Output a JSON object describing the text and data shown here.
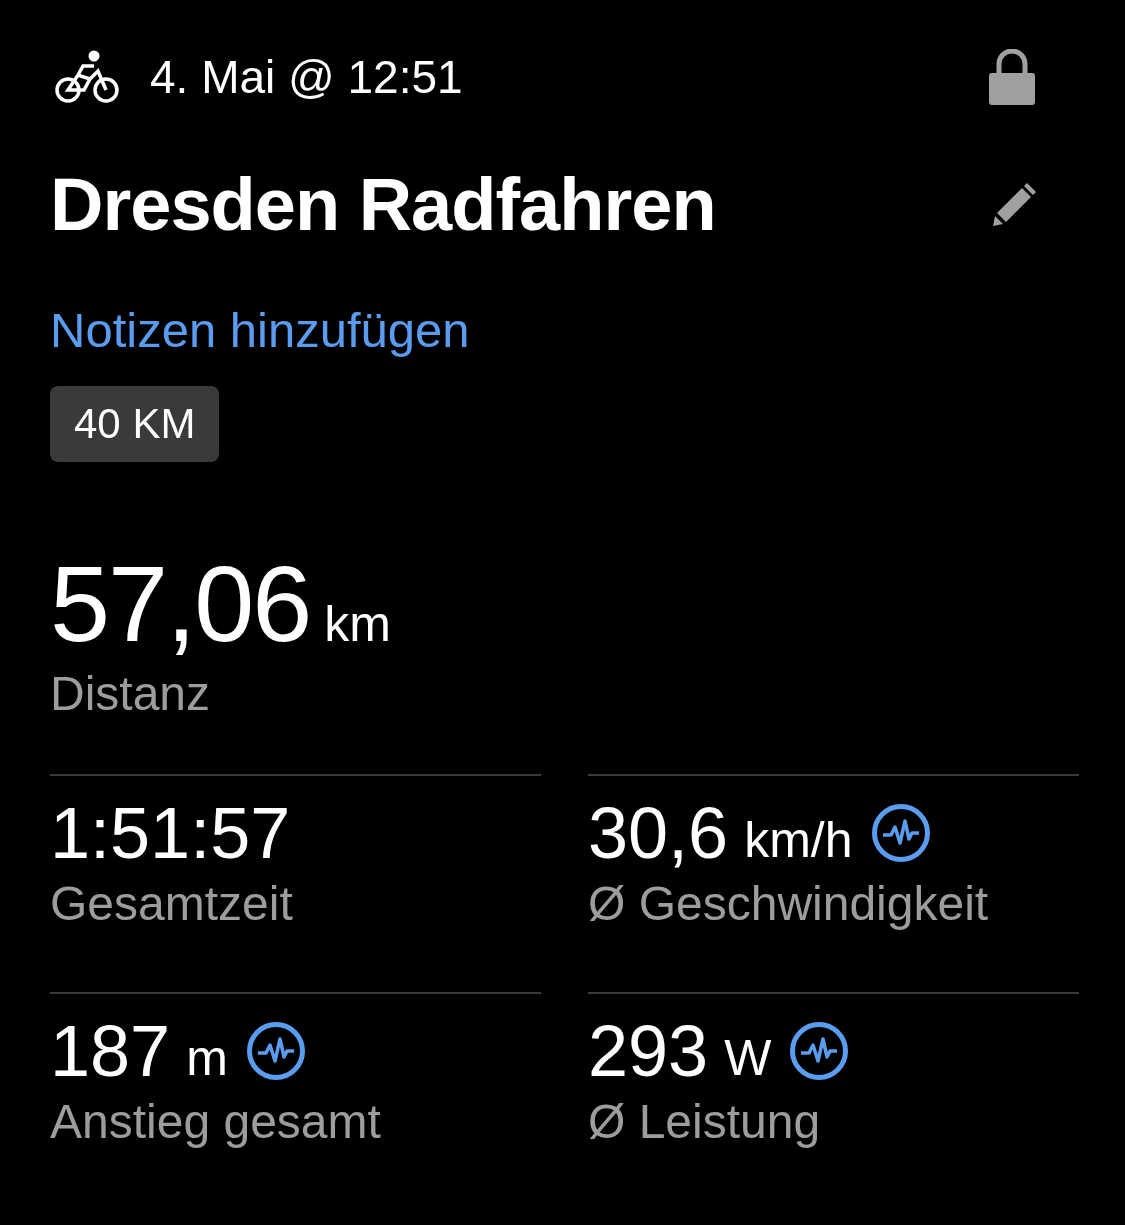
{
  "header": {
    "date": "4. Mai @ 12:51"
  },
  "title": "Dresden Radfahren",
  "notes_link": "Notizen hinzufügen",
  "tags": [
    "40 KM"
  ],
  "primary": {
    "value": "57,06",
    "unit": "km",
    "label": "Distanz"
  },
  "stats": [
    {
      "value": "1:51:57",
      "label": "Gesamtzeit",
      "detail_icon": false
    },
    {
      "value": "30,6",
      "unit": "km/h",
      "label": "Ø Geschwindigkeit",
      "detail_icon": true
    },
    {
      "value": "187",
      "unit": "m",
      "label": "Anstieg gesamt",
      "detail_icon": true
    },
    {
      "value": "293",
      "unit": "W",
      "label": "Ø Leistung",
      "detail_icon": true
    }
  ]
}
